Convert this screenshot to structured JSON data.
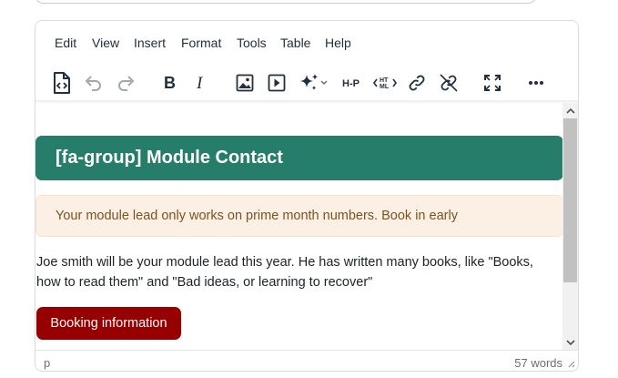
{
  "menu": {
    "items": [
      "Edit",
      "View",
      "Insert",
      "Format",
      "Tools",
      "Table",
      "Help"
    ]
  },
  "toolbar": {
    "buttons": [
      "source-code-icon",
      "undo-icon",
      "redo-icon",
      "bold-icon",
      "italic-icon",
      "image-icon",
      "media-icon",
      "ai-sparkle-icon",
      "h5p-icon",
      "html-icon",
      "link-icon",
      "unlink-icon",
      "fullscreen-icon",
      "more-icon"
    ],
    "h5p_label": "H-P",
    "html_label": "HT ML"
  },
  "content": {
    "header": "[fa-group] Module Contact",
    "alert": "Your module lead only works on prime month numbers. Book in early",
    "paragraph": "Joe smith will be your module lead this year. He has written many books, like \"Books, how to read them\" and \"Bad ideas, or learning to recover\"",
    "button": "Booking information"
  },
  "colors": {
    "header_bg": "#267d6a",
    "alert_bg": "#fbf0e3",
    "alert_text": "#7a5320",
    "button_bg": "#970000"
  },
  "status": {
    "path": "p",
    "word_count": "57 words"
  }
}
